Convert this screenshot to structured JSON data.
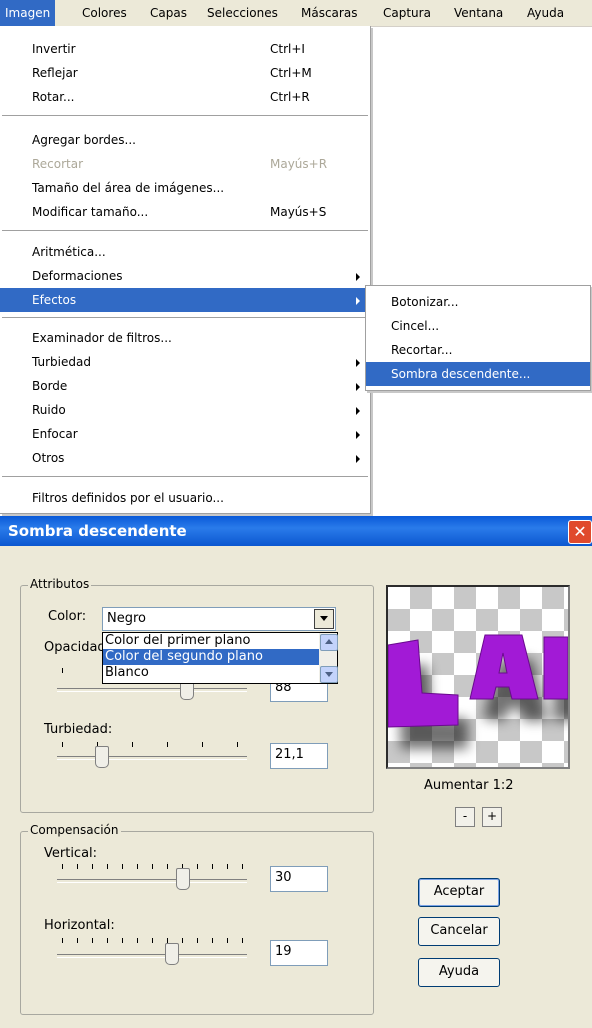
{
  "menubar": {
    "items": [
      "Imagen",
      "Colores",
      "Capas",
      "Selecciones",
      "Máscaras",
      "Captura",
      "Ventana",
      "Ayuda"
    ],
    "active": "Imagen"
  },
  "dropdown": {
    "invertir": {
      "label": "Invertir",
      "shortcut": "Ctrl+I"
    },
    "reflejar": {
      "label": "Reflejar",
      "shortcut": "Ctrl+M"
    },
    "rotar": {
      "label": "Rotar...",
      "shortcut": "Ctrl+R"
    },
    "agregar_bordes": {
      "label": "Agregar bordes..."
    },
    "recortar": {
      "label": "Recortar",
      "shortcut": "Mayús+R",
      "disabled": true
    },
    "tamano_area": {
      "label": "Tamaño del área de imágenes..."
    },
    "modificar_tamano": {
      "label": "Modificar tamaño...",
      "shortcut": "Mayús+S"
    },
    "aritmetica": {
      "label": "Aritmética..."
    },
    "deformaciones": {
      "label": "Deformaciones"
    },
    "efectos": {
      "label": "Efectos"
    },
    "examinador": {
      "label": "Examinador de filtros..."
    },
    "turbiedad": {
      "label": "Turbiedad"
    },
    "borde": {
      "label": "Borde"
    },
    "ruido": {
      "label": "Ruido"
    },
    "enfocar": {
      "label": "Enfocar"
    },
    "otros": {
      "label": "Otros"
    },
    "filtros_usuario": {
      "label": "Filtros definidos por el usuario..."
    }
  },
  "submenu": {
    "botonizar": "Botonizar...",
    "cincel": "Cincel...",
    "recortar": "Recortar...",
    "sombra": "Sombra descendente..."
  },
  "dialog": {
    "title": "Sombra descendente",
    "attributes_group": "Attributos",
    "color_label": "Color:",
    "color_value": "Negro",
    "color_options": [
      "Color del primer plano",
      "Color del segundo plano",
      "Blanco"
    ],
    "color_highlighted": "Color del segundo plano",
    "opacity_label": "Opacidad:",
    "opacity_value": "88",
    "blur_label": "Turbiedad:",
    "blur_value": "21,1",
    "offset_group": "Compensación",
    "vertical_label": "Vertical:",
    "vertical_value": "30",
    "horizontal_label": "Horizontal:",
    "horizontal_value": "19",
    "zoom_label": "Aumentar 1:2",
    "zoom_out": "-",
    "zoom_in": "+",
    "ok": "Aceptar",
    "cancel": "Cancelar",
    "help": "Ayuda",
    "close_glyph": "✕"
  },
  "colors": {
    "highlight": "#316ac5",
    "preview_text": "#a21ad6",
    "title_bar": "#0a5ad8",
    "close_button": "#e04a2c",
    "dialog_bg": "#ece9d8"
  }
}
